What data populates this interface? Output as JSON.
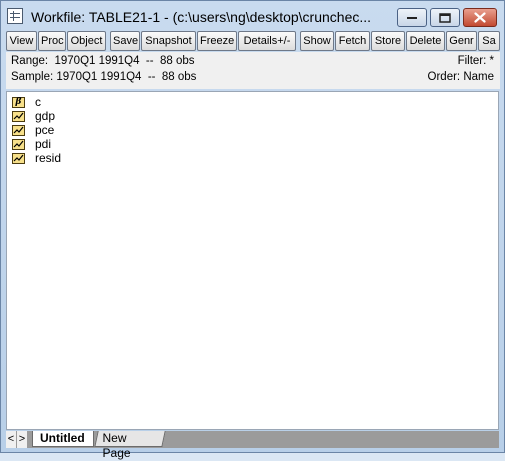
{
  "window": {
    "title": "Workfile: TABLE21-1 - (c:\\users\\ng\\desktop\\crunchec...",
    "controls": [
      {
        "name": "minimize-icon",
        "glyph": "▬"
      },
      {
        "name": "maximize-icon",
        "glyph": "▢"
      },
      {
        "name": "close-icon",
        "glyph": "✕"
      }
    ]
  },
  "toolbar": {
    "buttons": [
      "View",
      "Proc",
      "Object",
      "Save",
      "Snapshot",
      "Freeze",
      "Details+/-",
      "Show",
      "Fetch",
      "Store",
      "Delete",
      "Genr",
      "Sa"
    ]
  },
  "info": {
    "range_label": "Range:",
    "range_value": "1970Q1 1991Q4  --  88 obs",
    "filter": "Filter: *",
    "sample_label": "Sample:",
    "sample_value": "1970Q1 1991Q4  --  88 obs",
    "order": "Order: Name"
  },
  "objects": [
    {
      "name": "c",
      "icon": "coefficient-icon"
    },
    {
      "name": "gdp",
      "icon": "series-icon"
    },
    {
      "name": "pce",
      "icon": "series-icon"
    },
    {
      "name": "pdi",
      "icon": "series-icon"
    },
    {
      "name": "resid",
      "icon": "series-icon"
    }
  ],
  "tabs": {
    "scroll_left": "<",
    "scroll_right": ">",
    "items": [
      "Untitled",
      "New Page"
    ],
    "active": "Untitled"
  }
}
